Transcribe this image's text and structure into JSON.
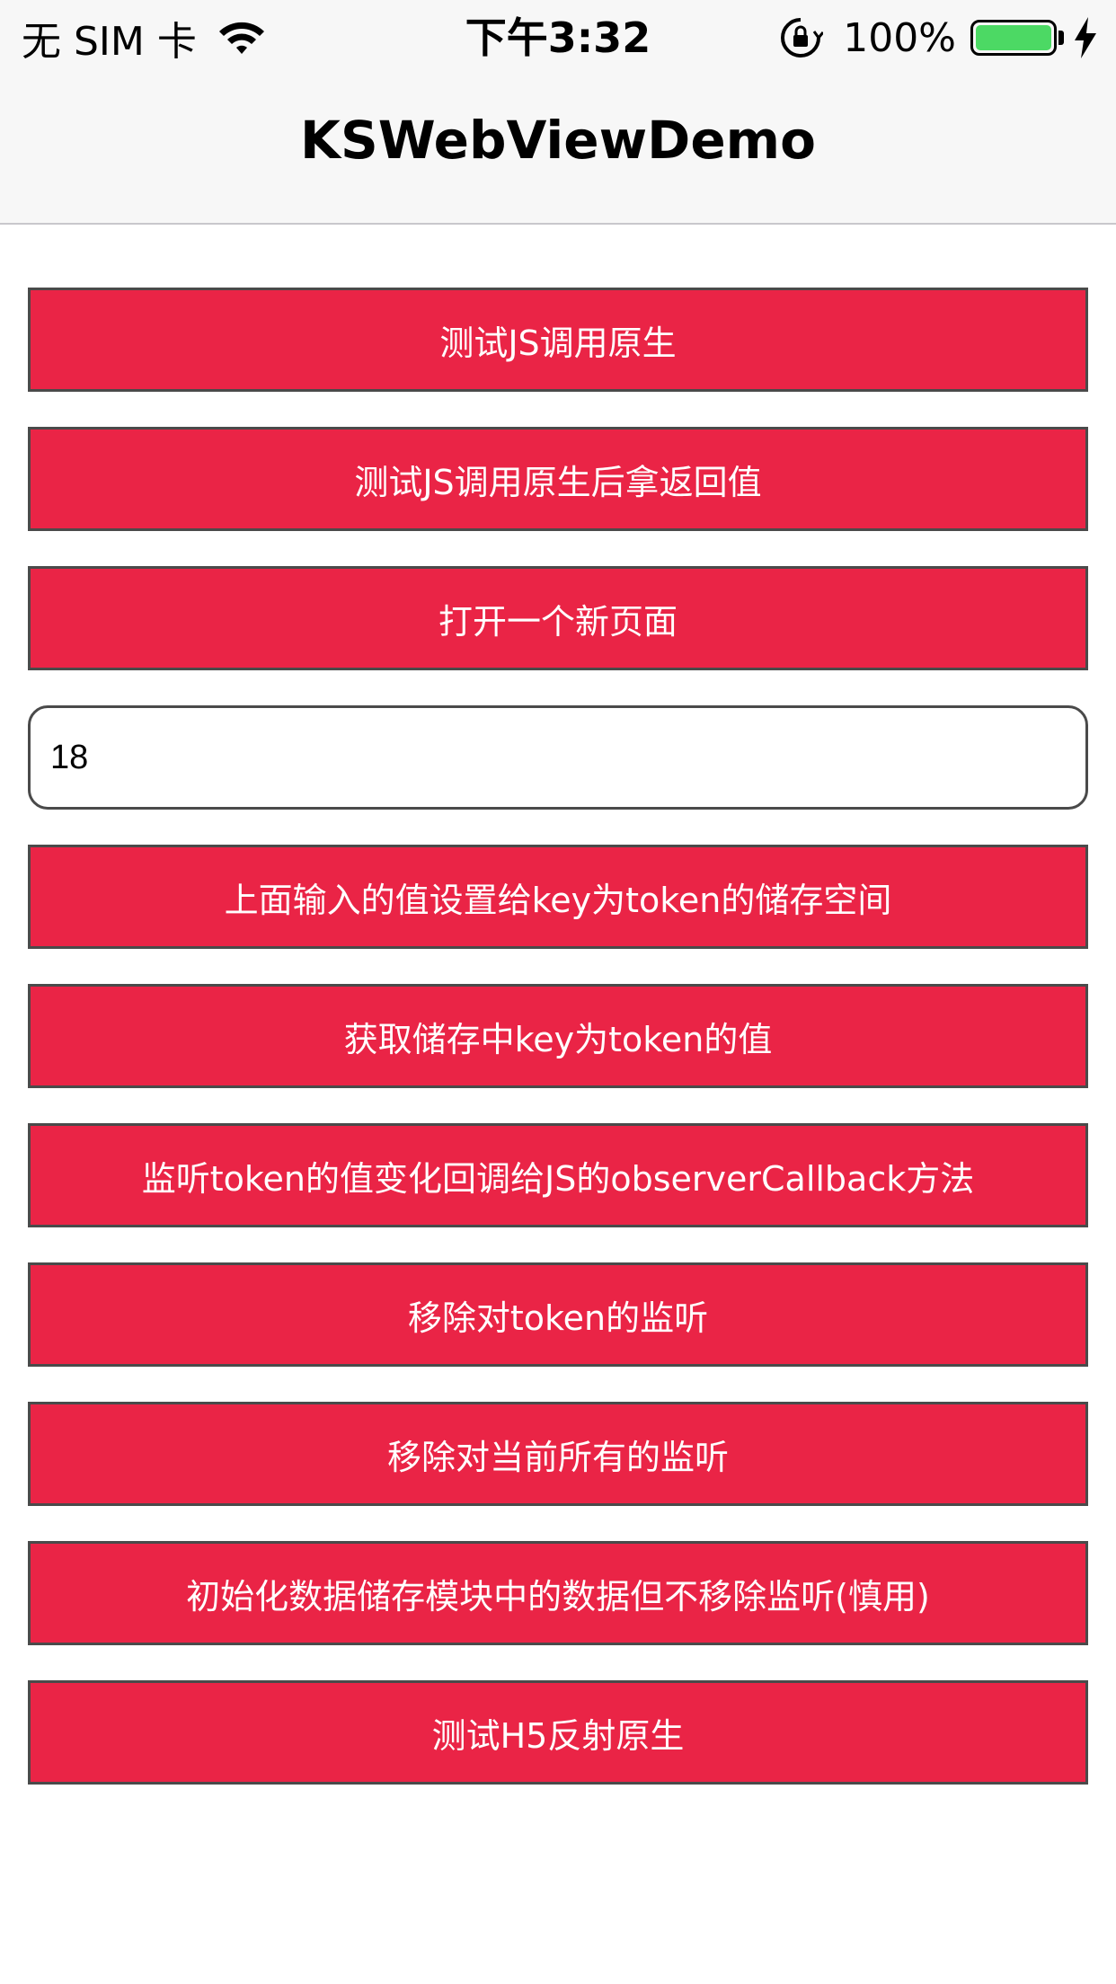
{
  "status_bar": {
    "carrier": "无 SIM 卡",
    "time": "下午3:32",
    "battery_percent": "100%",
    "battery_level": 1.0,
    "icons": [
      "wifi-icon",
      "orientation-lock-icon",
      "battery-icon",
      "charging-bolt-icon"
    ],
    "battery_color": "#4cd964"
  },
  "nav": {
    "title": "KSWebViewDemo"
  },
  "buttons": [
    {
      "label": "测试JS调用原生"
    },
    {
      "label": "测试JS调用原生后拿返回值"
    },
    {
      "label": "打开一个新页面"
    },
    {
      "label": "上面输入的值设置给key为token的储存空间"
    },
    {
      "label": "获取储存中key为token的值"
    },
    {
      "label": "监听token的值变化回调给JS的observerCallback方法"
    },
    {
      "label": "移除对token的监听"
    },
    {
      "label": "移除对当前所有的监听"
    },
    {
      "label": "初始化数据储存模块中的数据但不移除监听(慎用)"
    },
    {
      "label": "测试H5反射原生"
    }
  ],
  "token_input": {
    "value": "18"
  },
  "colors": {
    "button_bg": "#ea2446",
    "button_border": "#4a4a4a",
    "nav_bg": "#f7f7f7"
  }
}
